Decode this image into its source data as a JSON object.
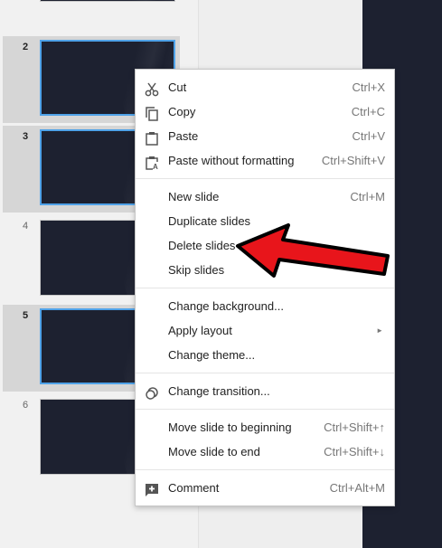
{
  "filmstrip": {
    "slides": [
      {
        "number": "",
        "selected": false
      },
      {
        "number": "2",
        "selected": true
      },
      {
        "number": "3",
        "selected": true
      },
      {
        "number": "4",
        "selected": false
      },
      {
        "number": "5",
        "selected": true
      },
      {
        "number": "6",
        "selected": false
      }
    ]
  },
  "context_menu": {
    "sections": [
      [
        {
          "label": "Cut",
          "shortcut": "Ctrl+X",
          "icon": "scissors-icon"
        },
        {
          "label": "Copy",
          "shortcut": "Ctrl+C",
          "icon": "copy-icon"
        },
        {
          "label": "Paste",
          "shortcut": "Ctrl+V",
          "icon": "clipboard-icon"
        },
        {
          "label": "Paste without formatting",
          "shortcut": "Ctrl+Shift+V",
          "icon": "clipboard-text-icon"
        }
      ],
      [
        {
          "label": "New slide",
          "shortcut": "Ctrl+M"
        },
        {
          "label": "Duplicate slides",
          "shortcut": ""
        },
        {
          "label": "Delete slides",
          "shortcut": ""
        },
        {
          "label": "Skip slides",
          "shortcut": ""
        }
      ],
      [
        {
          "label": "Change background...",
          "shortcut": ""
        },
        {
          "label": "Apply layout",
          "shortcut": "",
          "submenu": true
        },
        {
          "label": "Change theme...",
          "shortcut": ""
        }
      ],
      [
        {
          "label": "Change transition...",
          "shortcut": "",
          "icon": "transition-icon"
        }
      ],
      [
        {
          "label": "Move slide to beginning",
          "shortcut": "Ctrl+Shift+↑"
        },
        {
          "label": "Move slide to end",
          "shortcut": "Ctrl+Shift+↓"
        }
      ],
      [
        {
          "label": "Comment",
          "shortcut": "Ctrl+Alt+M",
          "icon": "add-comment-icon"
        }
      ]
    ]
  },
  "colors": {
    "slide_background": "#1d2130",
    "selection_border": "#4fa2e8",
    "annotation_arrow": "#e8151b"
  },
  "annotation": {
    "icon": "red-arrow-icon",
    "points_to": "Delete slides"
  }
}
